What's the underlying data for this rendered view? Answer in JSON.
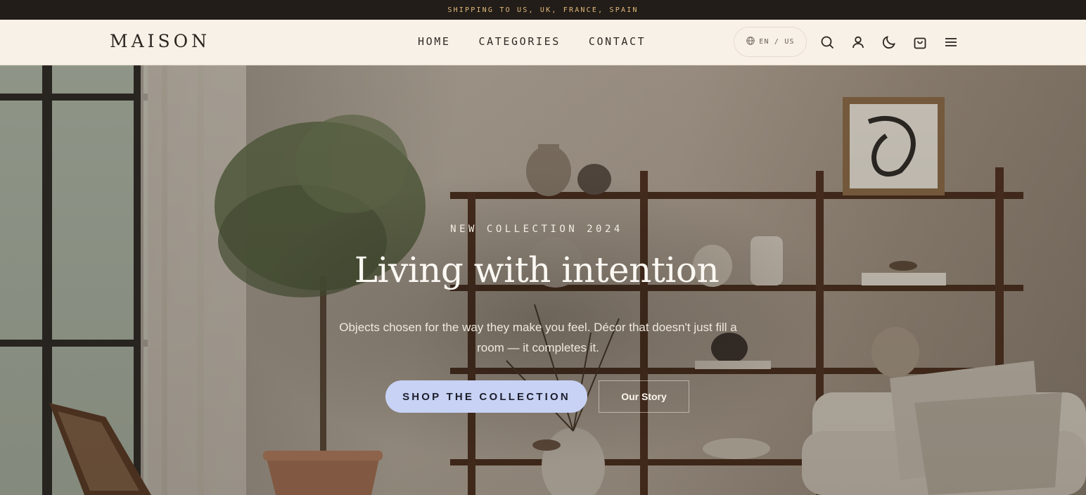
{
  "announcement": {
    "text": "SHIPPING TO US, UK, FRANCE, SPAIN"
  },
  "header": {
    "logo": "MAISON",
    "nav": [
      {
        "label": "HOME"
      },
      {
        "label": "CATEGORIES"
      },
      {
        "label": "CONTACT"
      }
    ],
    "locale": {
      "icon": "globe-icon",
      "label": "EN / US"
    },
    "icons": [
      "search-icon",
      "user-icon",
      "moon-icon",
      "cart-icon",
      "menu-icon"
    ]
  },
  "hero": {
    "eyebrow": "NEW COLLECTION 2024",
    "headline": "Living with intention",
    "subcopy": "Objects chosen for the way they make you feel. Décor that doesn't just fill a room — it completes it.",
    "primary_cta": "SHOP THE COLLECTION",
    "secondary_cta": "Our Story",
    "image_alt": ""
  },
  "colors": {
    "announcement_bg": "#221d18",
    "announcement_text": "#e2b97c",
    "header_bg": "#f8f1e7",
    "primary_button": "#c7d2f5"
  }
}
